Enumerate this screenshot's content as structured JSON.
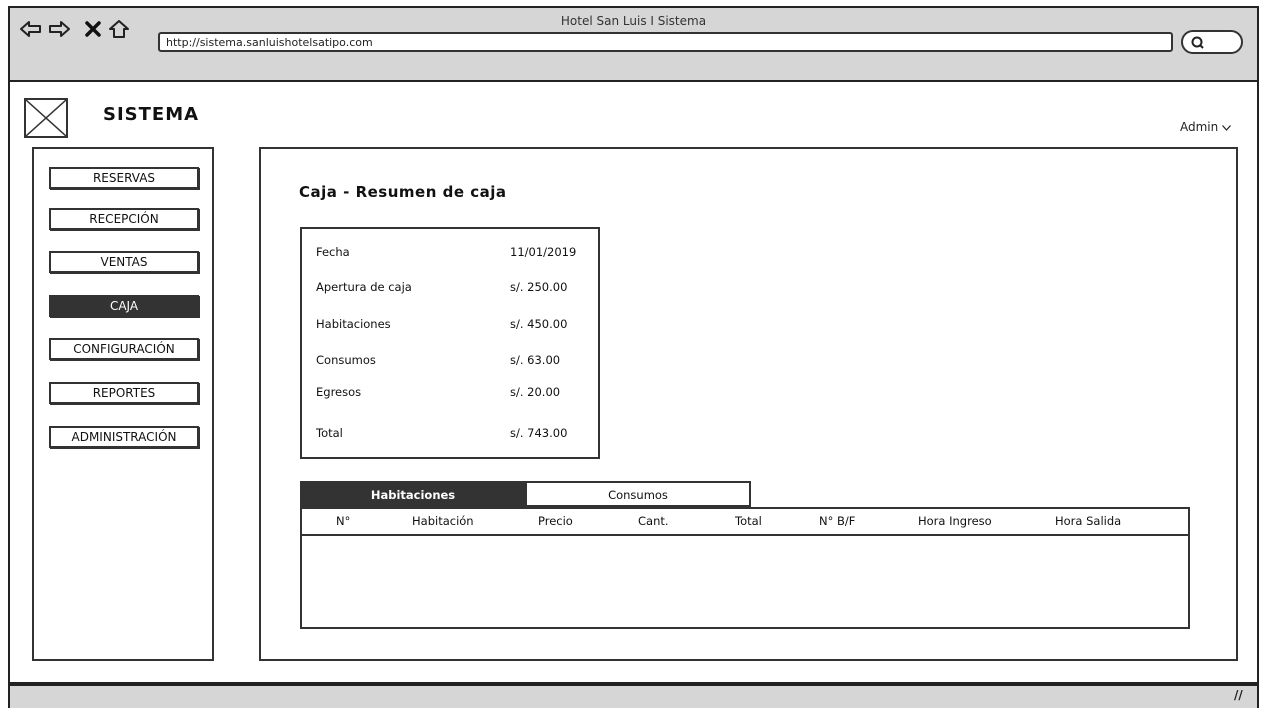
{
  "browser": {
    "window_title": "Hotel San Luis I Sistema",
    "url": "http://sistema.sanluishotelsatipo.com",
    "icons": [
      "back-arrow-icon",
      "forward-arrow-icon",
      "close-x-icon",
      "home-icon",
      "search-icon"
    ]
  },
  "header": {
    "brand": "SISTEMA",
    "user_menu": "Admin"
  },
  "sidebar": {
    "items": [
      {
        "label": "RESERVAS",
        "active": false
      },
      {
        "label": "RECEPCIÓN",
        "active": false
      },
      {
        "label": "VENTAS",
        "active": false
      },
      {
        "label": "CAJA",
        "active": true
      },
      {
        "label": "CONFIGURACIÓN",
        "active": false
      },
      {
        "label": "REPORTES",
        "active": false
      },
      {
        "label": "ADMINISTRACIÓN",
        "active": false
      }
    ]
  },
  "main": {
    "title": "Caja - Resumen de caja",
    "summary": [
      {
        "label": "Fecha",
        "value": "11/01/2019"
      },
      {
        "label": "Apertura de caja",
        "value": "s/. 250.00"
      },
      {
        "label": "Habitaciones",
        "value": "s/. 450.00"
      },
      {
        "label": "Consumos",
        "value": "s/. 63.00"
      },
      {
        "label": "Egresos",
        "value": "s/. 20.00"
      },
      {
        "label": "Total",
        "value": "s/. 743.00"
      }
    ],
    "tabs": [
      {
        "label": "Habitaciones",
        "active": true
      },
      {
        "label": "Consumos",
        "active": false
      }
    ],
    "table": {
      "columns": [
        "N°",
        "Habitación",
        "Precio",
        "Cant.",
        "Total",
        "N° B/F",
        "Hora Ingreso",
        "Hora Salida"
      ],
      "rows": []
    }
  },
  "colors": {
    "chrome": "#d6d6d6",
    "active_dark": "#333333",
    "border": "#333333"
  }
}
